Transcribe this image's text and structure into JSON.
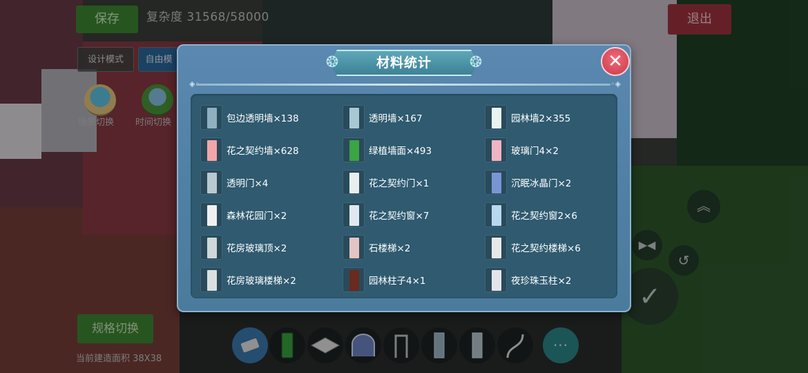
{
  "hud": {
    "save_label": "保存",
    "complexity_text": "复杂度 31568/58000",
    "exit_label": "退出",
    "mode_design": "设计模式",
    "mode_free": "自由模",
    "scene_switch": "场景切换",
    "time_switch": "时间切换",
    "spec_switch": "规格切换",
    "area_text": "当前建造面积 38X38"
  },
  "toolbar": {
    "items": [
      "eraser-icon",
      "green-wall-icon",
      "floor-tile-icon",
      "arch-gate-icon",
      "door-icon",
      "glass-wall-icon",
      "transparent-wall-icon",
      "spiral-stair-icon"
    ],
    "more_label": "···"
  },
  "modal": {
    "title": "材料统计",
    "close_label": "✕",
    "items": [
      {
        "label": "包边透明墙×138",
        "icon": "edged-glass-wall-icon",
        "color": "#8fb0c0"
      },
      {
        "label": "透明墙×167",
        "icon": "glass-wall-icon",
        "color": "#a9c8d6"
      },
      {
        "label": "园林墙2×355",
        "icon": "garden-wall-icon",
        "color": "#e8f4f4"
      },
      {
        "label": "花之契约墙×628",
        "icon": "flower-contract-wall-icon",
        "color": "#f2a6a8"
      },
      {
        "label": "绿植墙面×493",
        "icon": "green-plant-wall-icon",
        "color": "#3aa542"
      },
      {
        "label": "玻璃门4×2",
        "icon": "glass-door-icon",
        "color": "#f0b4c4"
      },
      {
        "label": "透明门×4",
        "icon": "transparent-door-icon",
        "color": "#b9c9cf"
      },
      {
        "label": "花之契约门×1",
        "icon": "flower-contract-door-icon",
        "color": "#e8eef0"
      },
      {
        "label": "沉眠冰晶门×2",
        "icon": "ice-crystal-door-icon",
        "color": "#7a95d6"
      },
      {
        "label": "森林花园门×2",
        "icon": "forest-garden-door-icon",
        "color": "#f0f0f0"
      },
      {
        "label": "花之契约窗×7",
        "icon": "flower-contract-window-icon",
        "color": "#dfe8f0"
      },
      {
        "label": "花之契约窗2×6",
        "icon": "flower-contract-window2-icon",
        "color": "#b8d8f0"
      },
      {
        "label": "花房玻璃顶×2",
        "icon": "greenhouse-glass-roof-icon",
        "color": "#cfd8d8"
      },
      {
        "label": "石楼梯×2",
        "icon": "stone-stair-icon",
        "color": "#e4c4c4"
      },
      {
        "label": "花之契约楼梯×6",
        "icon": "flower-contract-stair-icon",
        "color": "#e8e8e8"
      },
      {
        "label": "花房玻璃楼梯×2",
        "icon": "greenhouse-glass-stair-icon",
        "color": "#d8e0e0"
      },
      {
        "label": "园林柱子4×1",
        "icon": "garden-pillar-icon",
        "color": "#6a2a1e"
      },
      {
        "label": "夜珍珠玉柱×2",
        "icon": "night-pearl-pillar-icon",
        "color": "#e4e4ec"
      }
    ]
  },
  "colors": {
    "modal_bg": "#5b88b0",
    "content_bg": "#2f5a70",
    "close_red": "#d84656",
    "save_green": "#3f8a32",
    "exit_red": "#a43440"
  }
}
